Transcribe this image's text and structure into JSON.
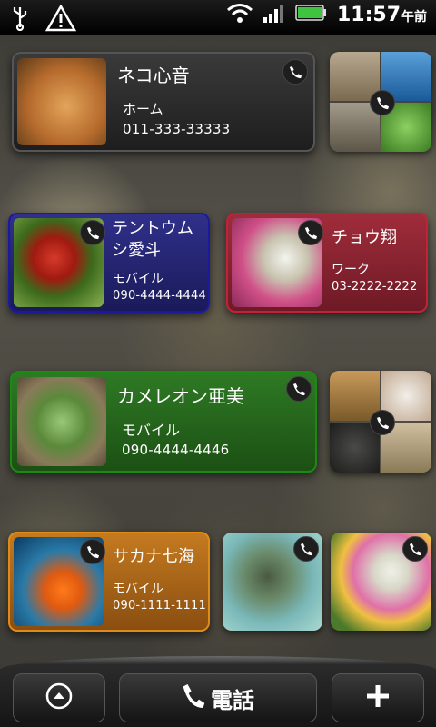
{
  "status": {
    "time": "11:57",
    "ampm": "午前"
  },
  "contacts": {
    "neko": {
      "name": "ネコ心音",
      "type": "ホーム",
      "number": "011-333-33333"
    },
    "tento": {
      "name": "テントウム\nシ愛斗",
      "type": "モバイル",
      "number": "090-4444-4444"
    },
    "chou": {
      "name": "チョウ翔",
      "type": "ワーク",
      "number": "03-2222-2222"
    },
    "kame": {
      "name": "カメレオン亜美",
      "type": "モバイル",
      "number": "090-4444-4446"
    },
    "sakana": {
      "name": "サカナ七海",
      "type": "モバイル",
      "number": "090-1111-1111"
    }
  },
  "dock": {
    "phone_label": "電話"
  },
  "colors": {
    "card_dark": "#2c2c2c",
    "card_blue": "#24246e",
    "card_red": "#8e2533",
    "card_green": "#2e6e22",
    "card_orange": "#b56a18"
  }
}
